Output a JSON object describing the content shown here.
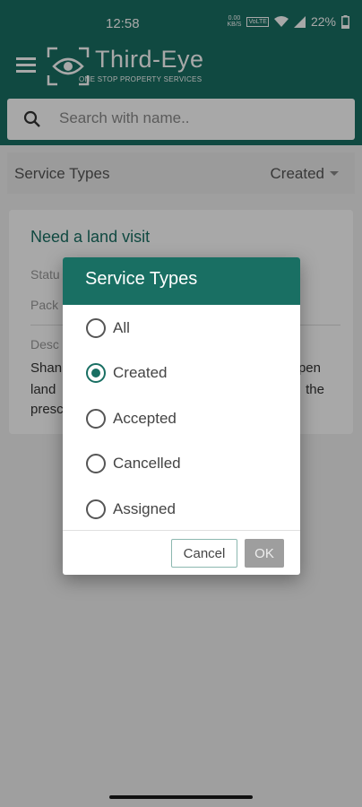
{
  "status_bar": {
    "time": "12:58",
    "net_top": "0.00",
    "net_bottom": "KB/S",
    "volte": "VoLTE",
    "battery": "22%"
  },
  "app_bar": {
    "title": "Third-Eye",
    "subtitle": "ONE STOP PROPERTY SERVICES"
  },
  "search": {
    "placeholder": "Search with name.."
  },
  "filter": {
    "label": "Service Types",
    "value": "Created"
  },
  "card": {
    "title": "Need a land visit",
    "status_fragment": "Statu",
    "package_fragment": "Pack",
    "description_fragment": "Desc",
    "line1_left": "Shan",
    "line1_right": "pen",
    "line2_left": "land",
    "line2_right": "the",
    "line3_left": "presc"
  },
  "dialog": {
    "title": "Service Types",
    "options": [
      {
        "label": "All",
        "selected": false
      },
      {
        "label": "Created",
        "selected": true
      },
      {
        "label": "Accepted",
        "selected": false
      },
      {
        "label": "Cancelled",
        "selected": false
      },
      {
        "label": "Assigned",
        "selected": false
      }
    ],
    "cancel_label": "Cancel",
    "ok_label": "OK"
  },
  "colors": {
    "primary": "#196f63",
    "ok_disabled": "#9e9e9e"
  },
  "icons": [
    "menu-icon",
    "eye-logo-icon",
    "search-icon",
    "dropdown-caret-icon",
    "radio-icon",
    "wifi-icon",
    "signal-icon",
    "battery-icon"
  ]
}
